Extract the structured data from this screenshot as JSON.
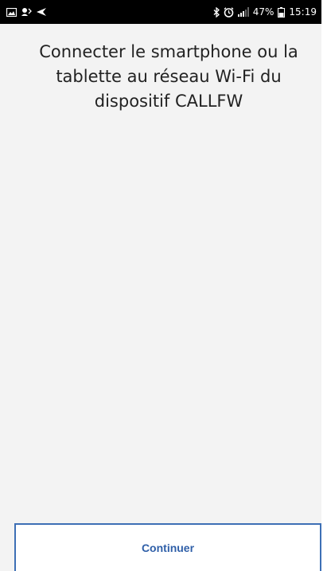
{
  "status_bar": {
    "battery_level": "47%",
    "time": "15:19",
    "icons": [
      "gallery-icon",
      "voicemail-icon",
      "navigation-icon",
      "bluetooth-icon",
      "alarm-icon",
      "signal-icon",
      "battery-icon"
    ]
  },
  "main": {
    "instruction": "Connecter le smartphone ou la tablette au réseau Wi-Fi du dispositif CALLFW"
  },
  "footer": {
    "continue_label": "Continuer"
  },
  "colors": {
    "accent": "#2f5fa8",
    "border": "#3d6fb5",
    "background": "#f3f3f3",
    "status_bar": "#000000"
  }
}
